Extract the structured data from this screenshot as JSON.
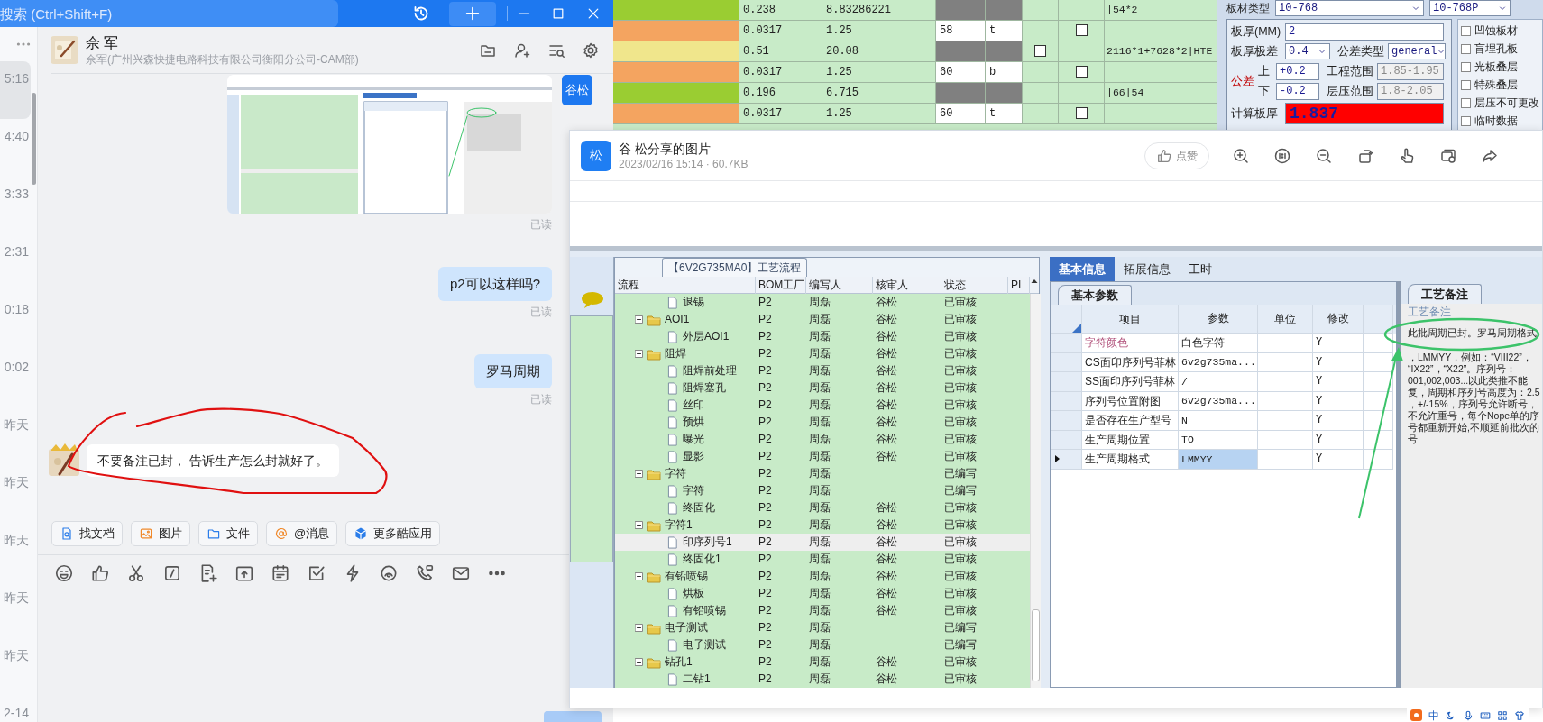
{
  "chat_window": {
    "search": {
      "placeholder": "搜索 (Ctrl+Shift+F)"
    },
    "conversations": [
      {
        "time": "5:16",
        "selected": true
      },
      {
        "time": "4:40",
        "selected": false
      },
      {
        "time": "3:33",
        "selected": false
      },
      {
        "time": "2:31",
        "selected": false
      },
      {
        "time": "0:18",
        "selected": false
      },
      {
        "time": "0:02",
        "selected": false
      },
      {
        "time": "昨天",
        "selected": false
      },
      {
        "time": "昨天",
        "selected": false
      },
      {
        "time": "昨天",
        "selected": false
      },
      {
        "time": "昨天",
        "selected": false
      },
      {
        "time": "昨天",
        "selected": false
      },
      {
        "time": "2-14",
        "selected": false
      }
    ],
    "contact": {
      "name": "佘 军",
      "subtitle": "佘军(广州兴森快捷电路科技有限公司衡阳分公司-CAM部)"
    },
    "messages": [
      {
        "kind": "image",
        "outgoing": true,
        "avatar": "谷松",
        "receipt": "已读"
      },
      {
        "kind": "text",
        "outgoing": true,
        "text": "p2可以这样吗?",
        "receipt": "已读"
      },
      {
        "kind": "text",
        "outgoing": true,
        "text": "罗马周期",
        "receipt": "已读"
      },
      {
        "kind": "text",
        "outgoing": false,
        "text": "不要备注已封， 告诉生产怎么封就好了。"
      }
    ],
    "quick_actions": [
      "找文档",
      "图片",
      "文件",
      "@消息",
      "更多酷应用"
    ]
  },
  "spreadsheet": {
    "rows": [
      {
        "color": "#9acd32",
        "cells": [
          {
            "kind": "text",
            "text": "0.238"
          },
          {
            "kind": "text",
            "text": "8.83286221"
          },
          {
            "kind": "shaded"
          },
          {
            "kind": "shaded"
          },
          {
            "kind": "empty"
          },
          {
            "kind": "empty"
          },
          {
            "kind": "text",
            "text": "|54*2"
          }
        ]
      },
      {
        "color": "#f4a460",
        "cells": [
          {
            "kind": "text",
            "text": "0.0317"
          },
          {
            "kind": "text",
            "text": "1.25"
          },
          {
            "kind": "text",
            "text": "58"
          },
          {
            "kind": "text",
            "text": "t"
          },
          {
            "kind": "empty"
          },
          {
            "kind": "checkbox",
            "checked": false
          },
          {
            "kind": "empty"
          }
        ]
      },
      {
        "color": "#f0e68c",
        "cells": [
          {
            "kind": "text",
            "text": "0.51"
          },
          {
            "kind": "text",
            "text": "20.08"
          },
          {
            "kind": "shaded"
          },
          {
            "kind": "shaded"
          },
          {
            "kind": "checkbox",
            "checked": false
          },
          {
            "kind": "empty"
          },
          {
            "kind": "text",
            "text": "2116*1+7628*2|HTE"
          }
        ]
      },
      {
        "color": "#f4a460",
        "cells": [
          {
            "kind": "text",
            "text": "0.0317"
          },
          {
            "kind": "text",
            "text": "1.25"
          },
          {
            "kind": "text",
            "text": "60"
          },
          {
            "kind": "text",
            "text": "b"
          },
          {
            "kind": "empty"
          },
          {
            "kind": "checkbox",
            "checked": false
          },
          {
            "kind": "empty"
          }
        ]
      },
      {
        "color": "#9acd32",
        "cells": [
          {
            "kind": "text",
            "text": "0.196"
          },
          {
            "kind": "text",
            "text": "6.715"
          },
          {
            "kind": "shaded"
          },
          {
            "kind": "shaded"
          },
          {
            "kind": "empty"
          },
          {
            "kind": "empty"
          },
          {
            "kind": "text",
            "text": "|66|54"
          }
        ]
      },
      {
        "color": "#f4a460",
        "cells": [
          {
            "kind": "text",
            "text": "0.0317"
          },
          {
            "kind": "text",
            "text": "1.25"
          },
          {
            "kind": "text",
            "text": "60"
          },
          {
            "kind": "text",
            "text": "t"
          },
          {
            "kind": "empty"
          },
          {
            "kind": "checkbox",
            "checked": false
          },
          {
            "kind": "empty"
          }
        ]
      }
    ],
    "board_type_label": "板材类型",
    "board_type": "10-768",
    "board_type_2": "10-768P",
    "form": {
      "thickness_label": "板厚(MM)",
      "thickness": "2",
      "range_label": "板厚极差",
      "range": "0.4",
      "tol_type_label": "公差类型",
      "tol_type": "general",
      "tol_label": "公差",
      "upper_label": "上",
      "upper": "+0.2",
      "lower_label": "下",
      "lower": "-0.2",
      "eng_label": "工程范围",
      "eng": "1.85-1.95",
      "press_label": "层压范围",
      "press": "1.8-2.05",
      "calc_label": "计算板厚",
      "calc": "1.837"
    },
    "options": [
      {
        "label": "凹蚀板材",
        "checked": false
      },
      {
        "label": "盲埋孔板",
        "checked": false
      },
      {
        "label": "光板叠层",
        "checked": false
      },
      {
        "label": "特殊叠层",
        "checked": false
      },
      {
        "label": "层压不可更改",
        "checked": false
      },
      {
        "label": "临时数据",
        "checked": false
      }
    ]
  },
  "image_viewer": {
    "avatar": "松",
    "title": "谷 松分享的图片",
    "meta": "2023/02/16 15:14 · 60.7KB",
    "like_button": "点赞",
    "shared_image": {
      "flow_title": "【6V2G735MA0】工艺流程",
      "columns": [
        "流程",
        "BOM工厂",
        "编写人",
        "核审人",
        "状态",
        "PI"
      ],
      "tree": [
        {
          "name": "退锡",
          "kind": "file",
          "bom": "P2",
          "writer": "周磊",
          "reviewer": "谷松",
          "status": "已审核",
          "selected": false
        },
        {
          "name": "AOI1",
          "kind": "folder",
          "expanded": true,
          "bom": "P2",
          "writer": "周磊",
          "reviewer": "谷松",
          "status": "已审核",
          "selected": false,
          "children": [
            {
              "name": "外层AOI1",
              "kind": "file",
              "bom": "P2",
              "writer": "周磊",
              "reviewer": "谷松",
              "status": "已审核",
              "selected": false
            }
          ]
        },
        {
          "name": "阻焊",
          "kind": "folder",
          "expanded": true,
          "bom": "P2",
          "writer": "周磊",
          "reviewer": "谷松",
          "status": "已审核",
          "selected": false,
          "children": [
            {
              "name": "阻焊前处理",
              "kind": "file",
              "bom": "P2",
              "writer": "周磊",
              "reviewer": "谷松",
              "status": "已审核",
              "selected": false
            },
            {
              "name": "阻焊塞孔",
              "kind": "file",
              "bom": "P2",
              "writer": "周磊",
              "reviewer": "谷松",
              "status": "已审核",
              "selected": false
            },
            {
              "name": "丝印",
              "kind": "file",
              "bom": "P2",
              "writer": "周磊",
              "reviewer": "谷松",
              "status": "已审核",
              "selected": false
            },
            {
              "name": "预烘",
              "kind": "file",
              "bom": "P2",
              "writer": "周磊",
              "reviewer": "谷松",
              "status": "已审核",
              "selected": false
            },
            {
              "name": "曝光",
              "kind": "file",
              "bom": "P2",
              "writer": "周磊",
              "reviewer": "谷松",
              "status": "已审核",
              "selected": false
            },
            {
              "name": "显影",
              "kind": "file",
              "bom": "P2",
              "writer": "周磊",
              "reviewer": "谷松",
              "status": "已审核",
              "selected": false
            }
          ]
        },
        {
          "name": "字符",
          "kind": "folder",
          "expanded": true,
          "bom": "P2",
          "writer": "周磊",
          "status": "已编写",
          "selected": false,
          "children": [
            {
              "name": "字符",
              "kind": "file",
              "bom": "P2",
              "writer": "周磊",
              "status": "已编写",
              "selected": false
            },
            {
              "name": "终固化",
              "kind": "file",
              "bom": "P2",
              "writer": "周磊",
              "reviewer": "谷松",
              "status": "已审核",
              "selected": false
            }
          ]
        },
        {
          "name": "字符1",
          "kind": "folder",
          "expanded": true,
          "bom": "P2",
          "writer": "周磊",
          "reviewer": "谷松",
          "status": "已审核",
          "selected": false,
          "children": [
            {
              "name": "印序列号1",
              "kind": "file",
              "bom": "P2",
              "writer": "周磊",
              "reviewer": "谷松",
              "status": "已审核",
              "selected": true
            },
            {
              "name": "终固化1",
              "kind": "file",
              "bom": "P2",
              "writer": "周磊",
              "reviewer": "谷松",
              "status": "已审核",
              "selected": false
            }
          ]
        },
        {
          "name": "有铅喷锡",
          "kind": "folder",
          "expanded": true,
          "bom": "P2",
          "writer": "周磊",
          "reviewer": "谷松",
          "status": "已审核",
          "selected": false,
          "children": [
            {
              "name": "烘板",
              "kind": "file",
              "bom": "P2",
              "writer": "周磊",
              "reviewer": "谷松",
              "status": "已审核",
              "selected": false
            },
            {
              "name": "有铅喷锡",
              "kind": "file",
              "bom": "P2",
              "writer": "周磊",
              "reviewer": "谷松",
              "status": "已审核",
              "selected": false
            }
          ]
        },
        {
          "name": "电子测试",
          "kind": "folder",
          "expanded": true,
          "bom": "P2",
          "writer": "周磊",
          "status": "已编写",
          "selected": false,
          "children": [
            {
              "name": "电子测试",
              "kind": "file",
              "bom": "P2",
              "writer": "周磊",
              "status": "已编写",
              "selected": false
            }
          ]
        },
        {
          "name": "钻孔1",
          "kind": "folder",
          "expanded": true,
          "bom": "P2",
          "writer": "周磊",
          "reviewer": "谷松",
          "status": "已审核",
          "selected": false,
          "children": [
            {
              "name": "二钻1",
              "kind": "file",
              "bom": "P2",
              "writer": "周磊",
              "reviewer": "谷松",
              "status": "已审核",
              "selected": false
            }
          ]
        }
      ],
      "tabs": [
        {
          "label": "基本信息",
          "selected": true
        },
        {
          "label": "拓展信息",
          "selected": false
        },
        {
          "label": "工时",
          "selected": false
        }
      ],
      "sub_tab": "基本参数",
      "param_columns": [
        "项目",
        "参数",
        "单位",
        "修改"
      ],
      "params": [
        {
          "item": "字符颜色",
          "color": "#b0507a",
          "value": "白色字符",
          "modify": "Y",
          "selected": false
        },
        {
          "item": "CS面印序列号菲林",
          "value": "6v2g735ma...",
          "modify": "Y",
          "selected": false
        },
        {
          "item": "SS面印序列号菲林",
          "value": "/",
          "modify": "Y",
          "selected": false
        },
        {
          "item": "序列号位置附图",
          "value": "6v2g735ma...",
          "modify": "Y",
          "selected": false
        },
        {
          "item": "是否存在生产型号",
          "value": "N",
          "modify": "Y",
          "selected": false
        },
        {
          "item": "生产周期位置",
          "value": "TO",
          "modify": "Y",
          "selected": false
        },
        {
          "item": "生产周期格式",
          "value": "LMMYY",
          "modify": "Y",
          "selected": true
        }
      ],
      "note_tab": "工艺备注",
      "note_label": "工艺备注",
      "note_lines": [
        "此批周期已封。罗马周期格式",
        "，LMMYY，例如：“VIII22”，",
        "“IX22”，“X22”。序列号：",
        "001,002,003...以此类推不能",
        "复，周期和序列号高度为：2.5",
        "，+/-15%，序列号允许断号，",
        "不允许重号，每个Nope单的序",
        "号都重新开始,不顺延前批次的",
        "号"
      ]
    }
  },
  "ime_bar": {
    "mode": "中"
  }
}
